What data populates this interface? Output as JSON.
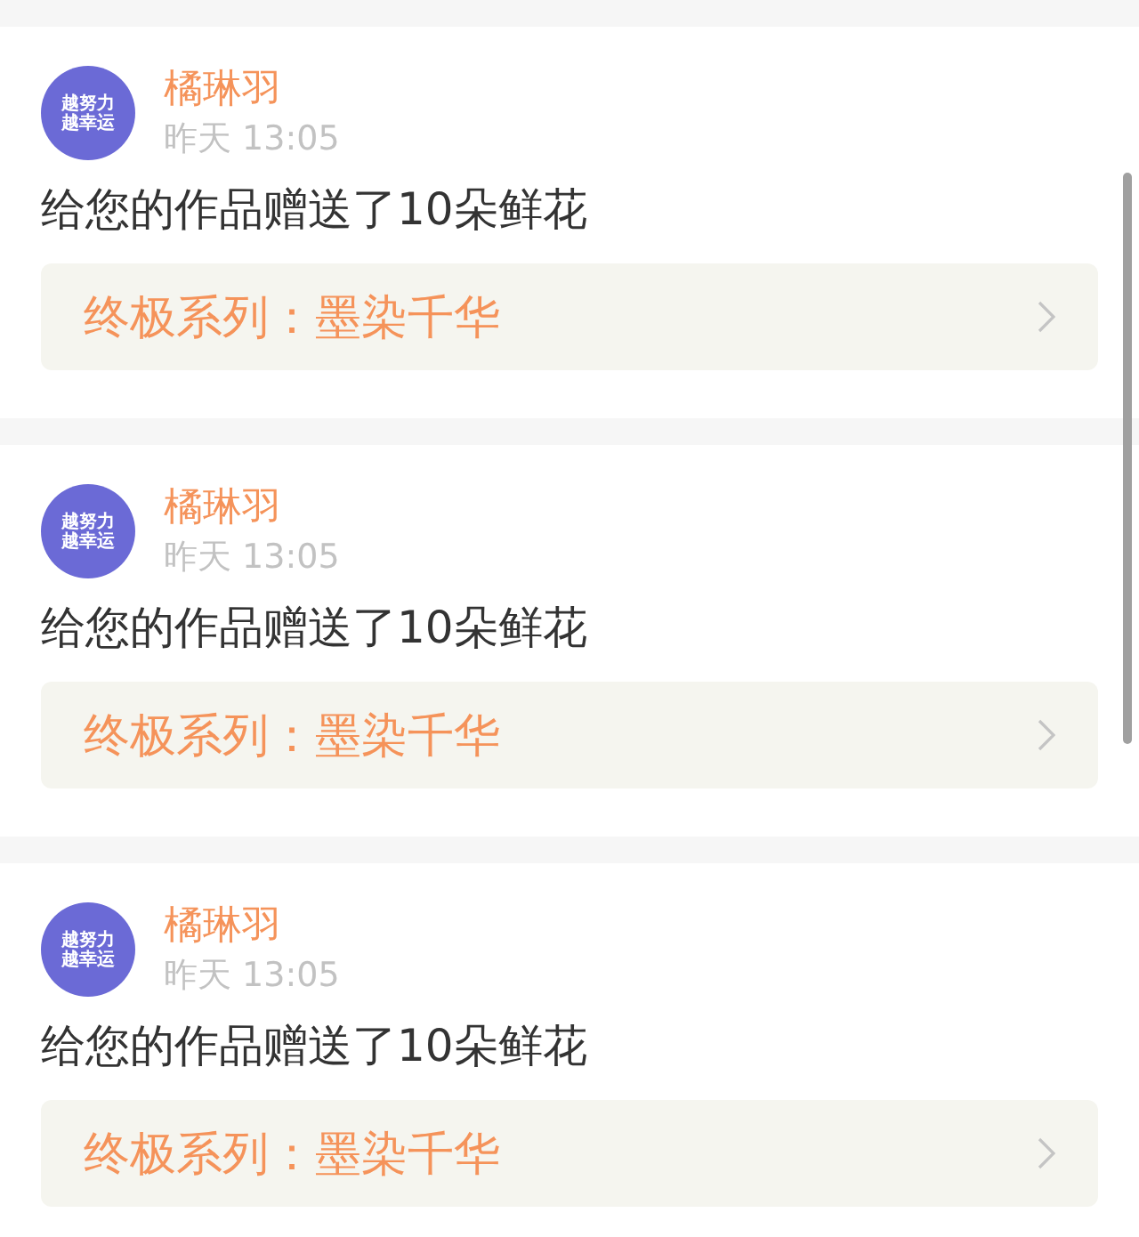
{
  "messages": [
    {
      "avatar_text": [
        "越努力",
        "越幸运"
      ],
      "name": "橘琳羽",
      "time": "昨天 13:05",
      "text": "给您的作品赠送了10朵鲜花",
      "work": "终极系列：墨染千华"
    },
    {
      "avatar_text": [
        "越努力",
        "越幸运"
      ],
      "name": "橘琳羽",
      "time": "昨天 13:05",
      "text": "给您的作品赠送了10朵鲜花",
      "work": "终极系列：墨染千华"
    },
    {
      "avatar_text": [
        "越努力",
        "越幸运"
      ],
      "name": "橘琳羽",
      "time": "昨天 13:05",
      "text": "给您的作品赠送了10朵鲜花",
      "work": "终极系列：墨染千华"
    }
  ]
}
